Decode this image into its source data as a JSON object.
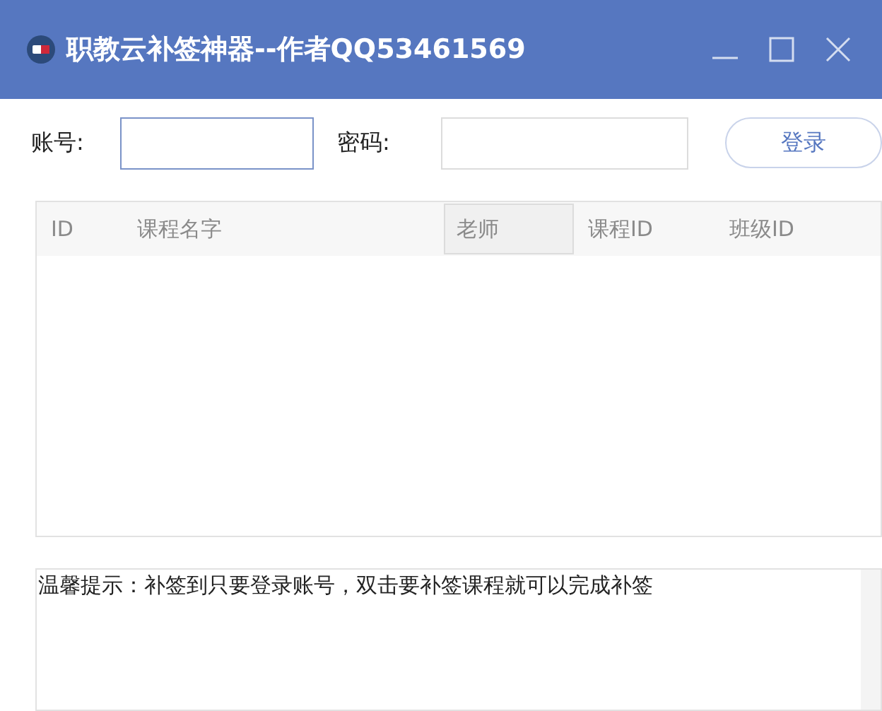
{
  "window": {
    "title": "职教云补签神器--作者QQ53461569"
  },
  "login": {
    "account_label": "账号:",
    "password_label": "密码:",
    "button": "登录"
  },
  "table": {
    "columns": [
      {
        "label": "ID",
        "selected": false
      },
      {
        "label": "课程名字",
        "selected": false
      },
      {
        "label": "老师",
        "selected": true
      },
      {
        "label": "课程ID",
        "selected": false
      },
      {
        "label": "班级ID",
        "selected": false
      }
    ]
  },
  "log": {
    "text": "温馨提示：补签到只要登录账号，双击要补签课程就可以完成补签"
  }
}
